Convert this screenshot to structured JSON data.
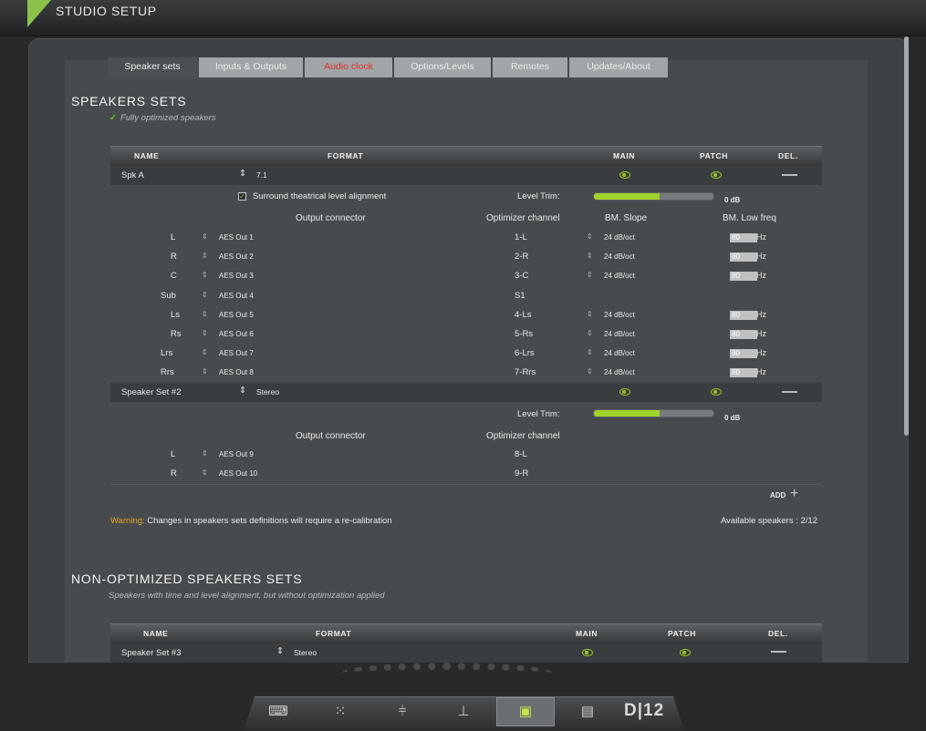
{
  "app": {
    "title": "STUDIO SETUP",
    "accent_color": "#8bc34a"
  },
  "tabs": [
    {
      "label": "Speaker sets",
      "active": true
    },
    {
      "label": "Inputs & Outputs"
    },
    {
      "label": "Audio clock",
      "alert": true
    },
    {
      "label": "Options/Levels"
    },
    {
      "label": "Remotes"
    },
    {
      "label": "Updates/About"
    }
  ],
  "speakers": {
    "title": "SPEAKERS SETS",
    "subtitle": "Fully optimized speakers",
    "columns": {
      "name": "NAME",
      "format": "FORMAT",
      "main": "MAIN",
      "patch": "PATCH",
      "del": "DEL."
    },
    "sets": [
      {
        "name": "Spk A",
        "format": "7.1",
        "surround_label": "Surround theatrical level alignment",
        "surround_checked": true,
        "level_trim_label": "Level Trim:",
        "level_trim_value": "0 dB",
        "level_trim_fill": 0.55,
        "headers": {
          "output": "Output connector",
          "optimizer": "Optimizer channel",
          "slope": "BM. Slope",
          "lowfreq": "BM. Low freq"
        },
        "channels": [
          {
            "ch": "L",
            "out": "AES Out 1",
            "opt": "1-L",
            "slope": "24 dB/oct",
            "freq": "80",
            "unit": "Hz"
          },
          {
            "ch": "R",
            "out": "AES Out 2",
            "opt": "2-R",
            "slope": "24 dB/oct",
            "freq": "80",
            "unit": "Hz"
          },
          {
            "ch": "C",
            "out": "AES Out 3",
            "opt": "3-C",
            "slope": "24 dB/oct",
            "freq": "80",
            "unit": "Hz"
          },
          {
            "ch": "Sub",
            "out": "AES Out 4",
            "opt": "S1"
          },
          {
            "ch": "Ls",
            "out": "AES Out 5",
            "opt": "4-Ls",
            "slope": "24 dB/oct",
            "freq": "80",
            "unit": "Hz"
          },
          {
            "ch": "Rs",
            "out": "AES Out 6",
            "opt": "5-Rs",
            "slope": "24 dB/oct",
            "freq": "80",
            "unit": "Hz"
          },
          {
            "ch": "Lrs",
            "out": "AES Out 7",
            "opt": "6-Lrs",
            "slope": "24 dB/oct",
            "freq": "80",
            "unit": "Hz"
          },
          {
            "ch": "Rrs",
            "out": "AES Out 8",
            "opt": "7-Rrs",
            "slope": "24 dB/oct",
            "freq": "80",
            "unit": "Hz"
          }
        ]
      },
      {
        "name": "Speaker Set #2",
        "format": "Stereo",
        "level_trim_label": "Level Trim:",
        "level_trim_value": "0 dB",
        "level_trim_fill": 0.55,
        "headers": {
          "output": "Output connector",
          "optimizer": "Optimizer channel"
        },
        "channels": [
          {
            "ch": "L",
            "out": "AES Out 9",
            "opt": "8-L"
          },
          {
            "ch": "R",
            "out": "AES Out 10",
            "opt": "9-R"
          }
        ]
      }
    ],
    "add_label": "ADD",
    "warning_label": "Warning:",
    "warning_text": " Changes in speakers sets definitions will require a re-calibration",
    "available": "Available speakers : 2/12"
  },
  "nonopt": {
    "title": "NON-OPTIMIZED SPEAKERS SETS",
    "subtitle": "Speakers with time and level alignment, but without optimization applied",
    "columns": {
      "name": "NAME",
      "format": "FORMAT",
      "main": "MAIN",
      "patch": "PATCH",
      "del": "DEL."
    },
    "sets": [
      {
        "name": "Speaker Set #3",
        "format": "Stereo"
      }
    ]
  },
  "dock": {
    "brand": "D|12",
    "items": [
      "console-icon",
      "matrix-icon",
      "faders-icon",
      "routing-icon",
      "speakers-icon",
      "files-icon"
    ]
  }
}
